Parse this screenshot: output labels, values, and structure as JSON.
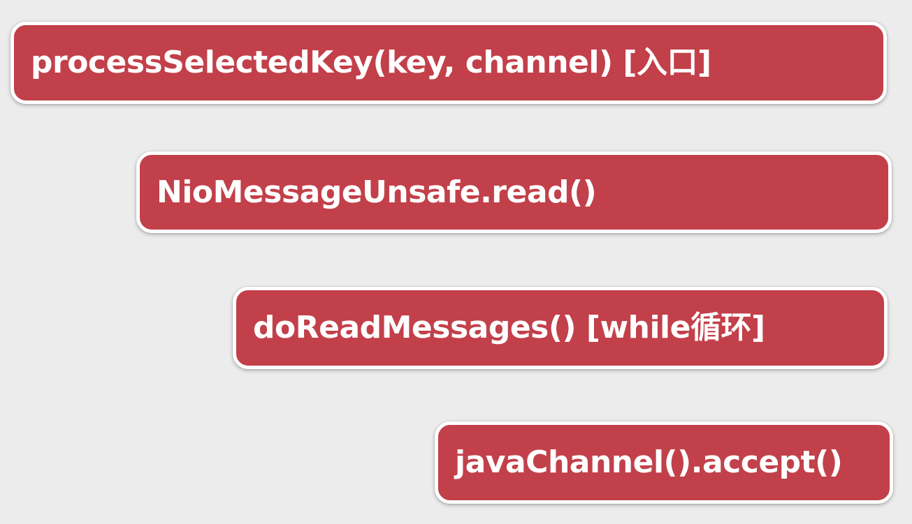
{
  "steps": [
    {
      "label": "processSelectedKey(key, channel) [入口]"
    },
    {
      "label": "NioMessageUnsafe.read()"
    },
    {
      "label": "doReadMessages() [while循环]"
    },
    {
      "label": "javaChannel().accept()"
    }
  ],
  "colors": {
    "background": "#ececec",
    "box_fill": "#c2404a",
    "box_border": "#ffffff",
    "text": "#ffffff"
  }
}
